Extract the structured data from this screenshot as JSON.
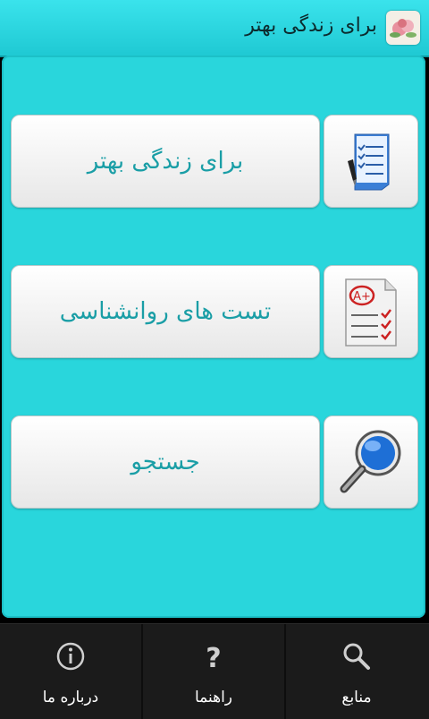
{
  "app_bar": {
    "title": "برای زندگی بهتر"
  },
  "menu": {
    "items": [
      {
        "label": "برای زندگی بهتر",
        "icon": "checklist-pen-icon"
      },
      {
        "label": "تست های روانشناسی",
        "icon": "test-grade-icon"
      },
      {
        "label": "جستجو",
        "icon": "magnifier-icon"
      }
    ]
  },
  "bottom_nav": {
    "items": [
      {
        "label": "درباره ما",
        "icon": "info-icon"
      },
      {
        "label": "راهنما",
        "icon": "question-icon"
      },
      {
        "label": "منابع",
        "icon": "search-icon"
      }
    ]
  },
  "colors": {
    "accent": "#29d6dc",
    "title_bar": "#2fd9e2",
    "button_text": "#1a9ea6",
    "nav_bg": "#1b1b1b"
  }
}
